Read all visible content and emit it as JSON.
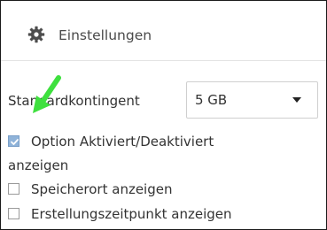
{
  "panel": {
    "title": "Einstellungen",
    "gear_icon": "gear-icon"
  },
  "quota": {
    "label": "Standardkontingent",
    "value": "5 GB"
  },
  "checkboxes": [
    {
      "label_line1": "Option Aktiviert/Deaktiviert",
      "label_line2": "anzeigen",
      "checked": true
    },
    {
      "label": "Speicherort anzeigen",
      "checked": false
    },
    {
      "label": "Erstellungszeitpunkt anzeigen",
      "checked": false
    }
  ],
  "colors": {
    "arrow": "#3ee03e",
    "checkbox_checked": "#8fb3d9"
  }
}
